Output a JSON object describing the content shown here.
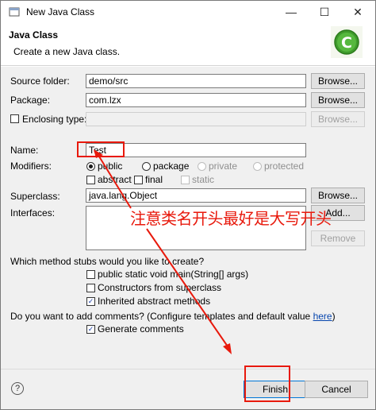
{
  "window": {
    "title": "New Java Class",
    "minimize_glyph": "—",
    "maximize_glyph": "☐",
    "close_glyph": "✕"
  },
  "header": {
    "title": "Java Class",
    "description": "Create a new Java class."
  },
  "form": {
    "source_folder": {
      "label": "Source folder:",
      "value": "demo/src",
      "button": "Browse..."
    },
    "package": {
      "label": "Package:",
      "value": "com.lzx",
      "button": "Browse..."
    },
    "enclosing_type": {
      "label": "Enclosing type:",
      "value": "",
      "button": "Browse...",
      "checked": false
    },
    "name": {
      "label": "Name:",
      "value": "Test"
    },
    "modifiers": {
      "label": "Modifiers:",
      "public": "public",
      "package": "package",
      "private": "private",
      "protected": "protected",
      "abstract": "abstract",
      "final": "final",
      "static": "static"
    },
    "superclass": {
      "label": "Superclass:",
      "value": "java.lang.Object",
      "button": "Browse..."
    },
    "interfaces": {
      "label": "Interfaces:",
      "add_button": "Add...",
      "remove_button": "Remove"
    },
    "stubs": {
      "question": "Which method stubs would you like to create?",
      "main": "public static void main(String[] args)",
      "constructors": "Constructors from superclass",
      "inherited": "Inherited abstract methods"
    },
    "comments": {
      "question": "Do you want to add comments? (Configure templates and default value ",
      "link": "here",
      "question_end": ")",
      "generate": "Generate comments"
    }
  },
  "footer": {
    "help_glyph": "?",
    "finish": "Finish",
    "cancel": "Cancel"
  },
  "annotation": {
    "text": "注意类名开头最好是大写开头",
    "color": "#e8190c"
  }
}
